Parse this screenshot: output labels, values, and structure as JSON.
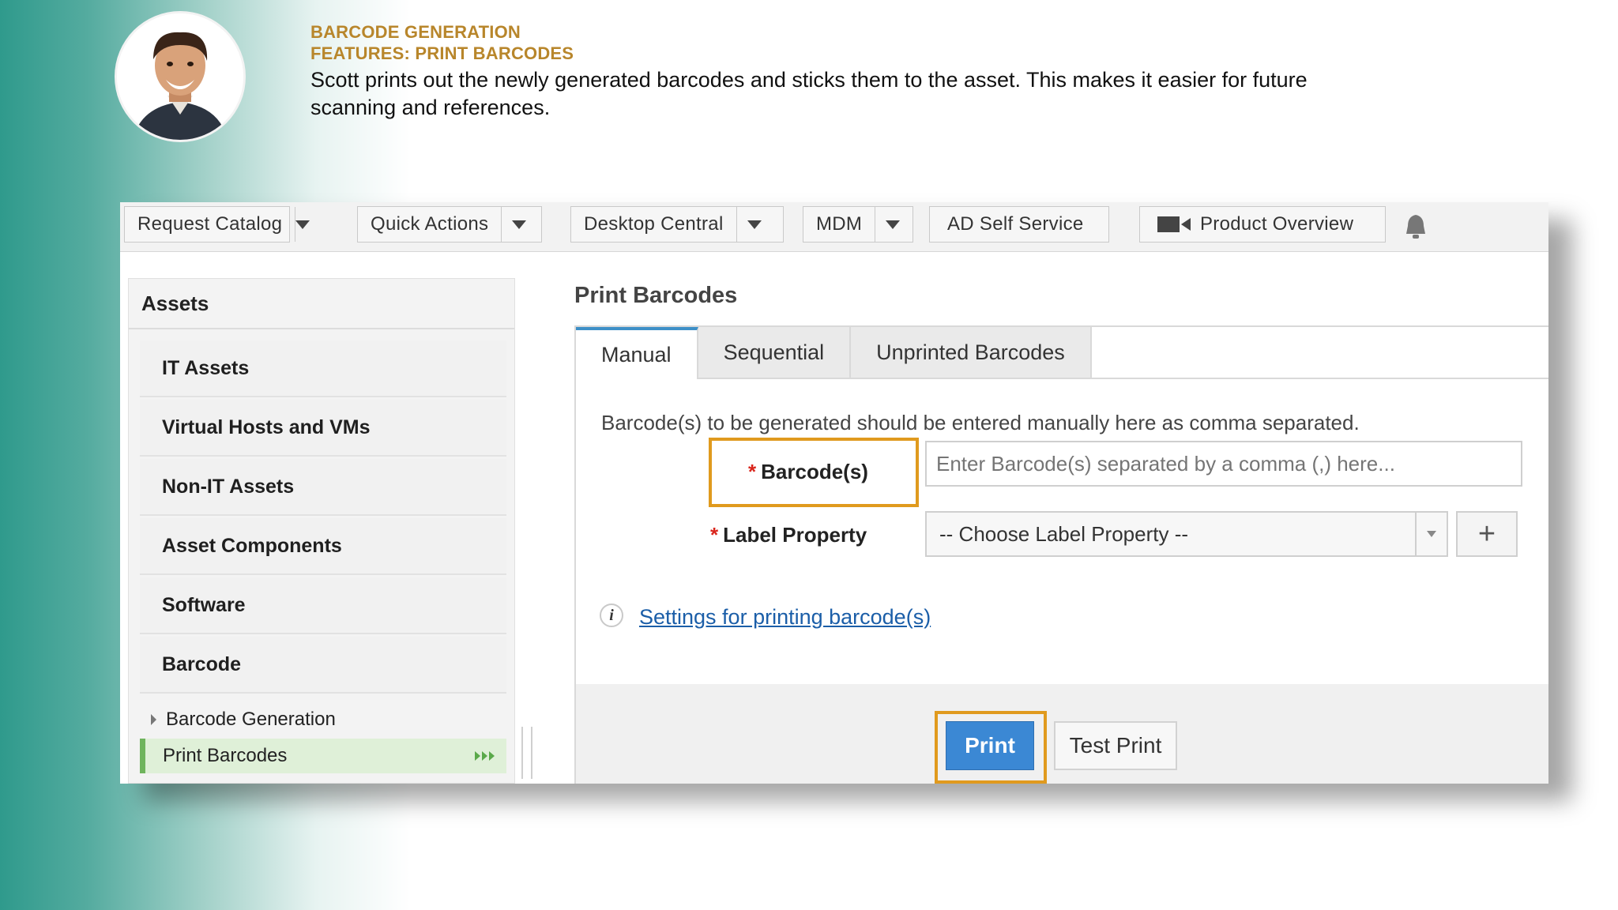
{
  "header": {
    "line1": "BARCODE GENERATION",
    "line2": "FEATURES: PRINT BARCODES",
    "description": "Scott prints out the newly generated barcodes and sticks them to the asset. This makes it easier for future scanning and references."
  },
  "topbar": {
    "request_catalog": "Request Catalog",
    "quick_actions": "Quick Actions",
    "desktop_central": "Desktop Central",
    "mdm": "MDM",
    "ad_self_service": "AD Self Service",
    "product_overview": "Product Overview"
  },
  "sidebar": {
    "title": "Assets",
    "items": [
      "IT Assets",
      "Virtual Hosts and VMs",
      "Non-IT Assets",
      "Asset Components",
      "Software",
      "Barcode"
    ],
    "sub_items": [
      "Barcode Generation",
      "Print Barcodes"
    ]
  },
  "main": {
    "title": "Print Barcodes",
    "tabs": [
      "Manual",
      "Sequential",
      "Unprinted Barcodes"
    ],
    "help_text": "Barcode(s) to be generated should be entered manually here as comma separated.",
    "required_mark": "*",
    "barcode_label": "Barcode(s)",
    "barcode_placeholder": "Enter Barcode(s) separated by a comma (,) here...",
    "label_property": "Label Property",
    "label_property_value": "-- Choose Label Property --",
    "plus": "+",
    "info": "i",
    "settings_link": "Settings for printing barcode(s)",
    "print_label": "Print",
    "test_print_label": "Test Print"
  },
  "colors": {
    "accent_orange": "#e09a1e",
    "primary_blue": "#3b88d4",
    "heading_gold": "#b8862b",
    "active_green": "#dff0d8"
  }
}
